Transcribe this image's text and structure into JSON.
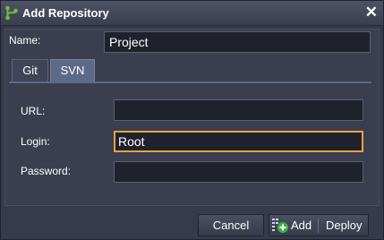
{
  "dialog": {
    "title": "Add Repository",
    "close_symbol": "✕"
  },
  "name_field": {
    "label": "Name:",
    "value": "Project"
  },
  "tabs": [
    {
      "label": "Git",
      "active": false
    },
    {
      "label": "SVN",
      "active": true
    }
  ],
  "svn_form": {
    "url_label": "URL:",
    "url_value": "",
    "login_label": "Login:",
    "login_value": "Root",
    "password_label": "Password:",
    "password_value": ""
  },
  "footer": {
    "cancel_label": "Cancel",
    "add_label": "Add",
    "deploy_label": "Deploy"
  },
  "colors": {
    "focus_border": "#e8a240",
    "active_tab": "#5c6a87",
    "add_icon_green": "#3cb043"
  },
  "icons": [
    "branch-logo-icon",
    "close-icon",
    "add-deploy-icon"
  ]
}
